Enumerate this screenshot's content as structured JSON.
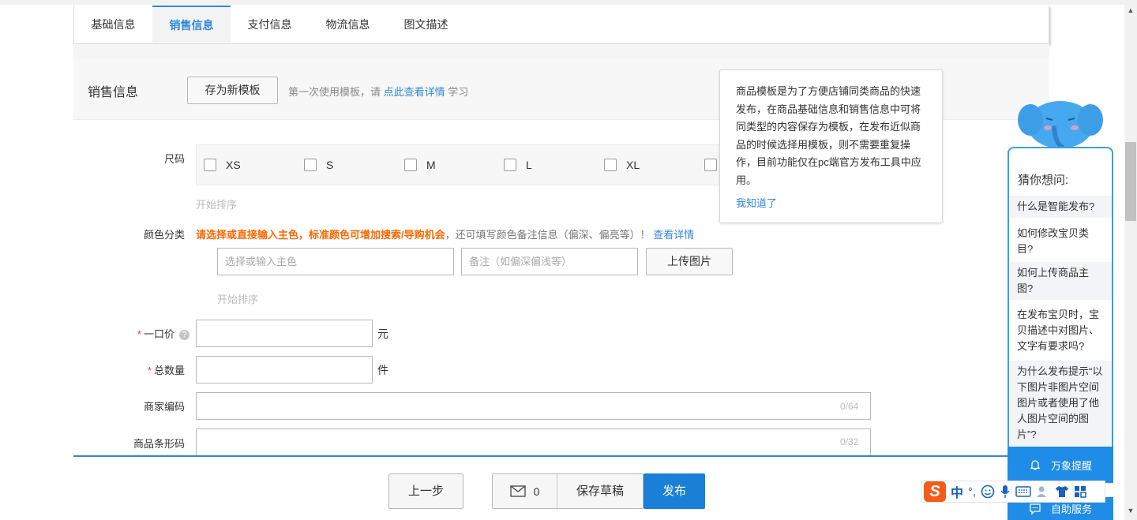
{
  "tabs": [
    "基础信息",
    "销售信息",
    "支付信息",
    "物流信息",
    "图文描述"
  ],
  "active_tab_index": 1,
  "section": {
    "title": "销售信息",
    "save_template_label": "存为新模板",
    "tip_prefix": "第一次使用模板，请",
    "tip_link": "点此查看详情",
    "tip_suffix": "学习"
  },
  "size": {
    "label": "尺码",
    "options": [
      "XS",
      "S",
      "M",
      "L",
      "XL"
    ],
    "sort_text": "开始排序"
  },
  "color": {
    "label": "颜色分类",
    "highlight": "请选择或直接输入主色，标准颜色可增加搜索/导购机会",
    "note": "，还可填写颜色备注信息（偏深、偏亮等）！",
    "link": "查看详情",
    "main_placeholder": "选择或输入主色",
    "remark_placeholder": "备注（如偏深偏浅等）",
    "upload_label": "上传图片",
    "sort_text": "开始排序"
  },
  "price": {
    "required": "*",
    "label": "一口价",
    "help": "?",
    "unit": "元"
  },
  "quantity": {
    "required": "*",
    "label": "总数量",
    "unit": "件"
  },
  "merchant_code": {
    "label": "商家编码",
    "counter": "0/64"
  },
  "barcode": {
    "label": "商品条形码",
    "counter": "0/32"
  },
  "tooltip": {
    "text": "商品模板是为了方便店铺同类商品的快速发布，在商品基础信息和销售信息中可将同类型的内容保存为模板，在发布近似商品的时候选择用模板，则不需要重复操作，目前功能仅在pc端官方发布工具中应用。",
    "confirm": "我知道了"
  },
  "bottom": {
    "prev_label": "上一步",
    "message_count": "0",
    "draft_label": "保存草稿",
    "publish_label": "发布"
  },
  "help_panel": {
    "title": "猜你想问:",
    "questions": [
      "什么是智能发布?",
      "如何修改宝贝类目?",
      "如何上传商品主图?",
      "在发布宝贝时，宝贝描述中对图片、文字有要求吗?",
      "为什么发布提示“以下图片非图片空间图片或者使用了他人图片空间的图片”?"
    ],
    "footer_reminder": "万象提醒",
    "footer_service": "自助服务"
  },
  "ime": {
    "logo": "S",
    "mode": "中",
    "punct": "°,"
  },
  "colors": {
    "accent": "#3089dc",
    "publish": "#1a7fd6",
    "orange": "#ff6700",
    "help_blue": "#1f8ce8"
  }
}
